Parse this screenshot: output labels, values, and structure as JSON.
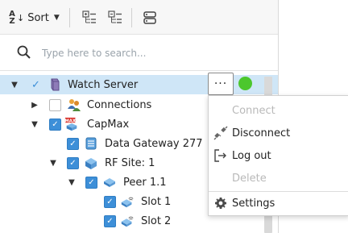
{
  "toolbar": {
    "sort_label": "Sort",
    "sort_icon": "sort-az-icon",
    "expand_all_icon": "expand-all-icon",
    "collapse_all_icon": "collapse-all-icon",
    "view_icon": "server-view-icon"
  },
  "search": {
    "placeholder": "Type here to search..."
  },
  "tree": {
    "items": [
      {
        "label": "Watch Server",
        "icon": "watch-server-icon",
        "checked": "plain",
        "expanded": true
      },
      {
        "label": "Connections",
        "icon": "connections-icon",
        "checked": "off",
        "expanded": false
      },
      {
        "label": "CapMax",
        "icon": "capmax-icon",
        "checked": "on",
        "expanded": true
      },
      {
        "label": "Data Gateway 277",
        "icon": "data-gateway-icon",
        "checked": "on",
        "expanded": false
      },
      {
        "label": "RF Site: 1",
        "icon": "rf-site-icon",
        "checked": "on",
        "expanded": true
      },
      {
        "label": "Peer 1.1",
        "icon": "peer-icon",
        "checked": "on",
        "expanded": true
      },
      {
        "label": "Slot 1",
        "icon": "slot-icon",
        "checked": "on",
        "expanded": false
      },
      {
        "label": "Slot 2",
        "icon": "slot-icon",
        "checked": "on",
        "expanded": false
      }
    ]
  },
  "row_actions": {
    "more_label": "···",
    "status_color": "#4cc72d"
  },
  "context_menu": {
    "items": [
      {
        "label": "Connect",
        "enabled": false,
        "icon": ""
      },
      {
        "label": "Disconnect",
        "enabled": true,
        "icon": "disconnect-plug-icon"
      },
      {
        "label": "Log out",
        "enabled": true,
        "icon": "logout-icon"
      },
      {
        "label": "Delete",
        "enabled": false,
        "icon": ""
      },
      {
        "label": "Settings",
        "enabled": true,
        "icon": "gear-icon"
      }
    ]
  },
  "colors": {
    "selection": "#cfe6f7",
    "checkbox": "#3d8fd8",
    "status_ok": "#4cc72d",
    "disabled_text": "#b9b9b9"
  }
}
